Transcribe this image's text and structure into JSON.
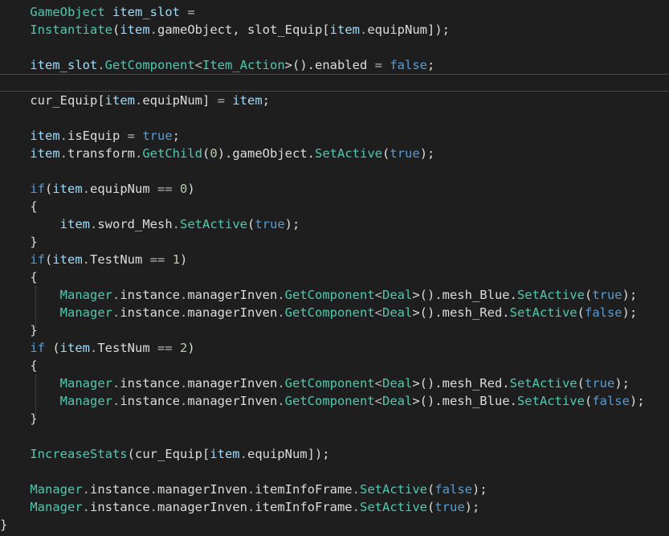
{
  "editor": {
    "language": "C#",
    "theme": "dark",
    "colors": {
      "background": "#1e1e1e",
      "type": "#4ec9b0",
      "variable": "#9cdcfe",
      "plain": "#dcdcdc",
      "keyword": "#569cd6",
      "number": "#b5cea8",
      "current_line_border": "#464646"
    },
    "current_line_index": 4,
    "lines": [
      {
        "tokens": [
          {
            "t": "    "
          },
          {
            "t": "GameObject",
            "c": "type"
          },
          {
            "t": " "
          },
          {
            "t": "item_slot",
            "c": "var"
          },
          {
            "t": " ",
            "c": "plain"
          },
          {
            "t": "=",
            "c": "op"
          }
        ]
      },
      {
        "tokens": [
          {
            "t": "    "
          },
          {
            "t": "Instantiate",
            "c": "type"
          },
          {
            "t": "(",
            "c": "plain"
          },
          {
            "t": "item",
            "c": "var"
          },
          {
            "t": ".",
            "c": "op"
          },
          {
            "t": "gameObject",
            "c": "plain"
          },
          {
            "t": ", slot_Equip[",
            "c": "plain"
          },
          {
            "t": "item",
            "c": "var"
          },
          {
            "t": ".",
            "c": "op"
          },
          {
            "t": "equipNum",
            "c": "plain"
          },
          {
            "t": "]);",
            "c": "plain"
          }
        ]
      },
      {
        "tokens": []
      },
      {
        "tokens": [
          {
            "t": "    "
          },
          {
            "t": "item_slot",
            "c": "var"
          },
          {
            "t": ".",
            "c": "op"
          },
          {
            "t": "GetComponent",
            "c": "type"
          },
          {
            "t": "<",
            "c": "op"
          },
          {
            "t": "Item_Action",
            "c": "type"
          },
          {
            "t": ">().enabled ",
            "c": "plain"
          },
          {
            "t": "=",
            "c": "op"
          },
          {
            "t": " "
          },
          {
            "t": "false",
            "c": "kw"
          },
          {
            "t": ";",
            "c": "plain"
          }
        ]
      },
      {
        "tokens": []
      },
      {
        "tokens": [
          {
            "t": "    "
          },
          {
            "t": "cur_Equip[",
            "c": "plain"
          },
          {
            "t": "item",
            "c": "var"
          },
          {
            "t": ".",
            "c": "op"
          },
          {
            "t": "equipNum] ",
            "c": "plain"
          },
          {
            "t": "=",
            "c": "op"
          },
          {
            "t": " "
          },
          {
            "t": "item",
            "c": "var"
          },
          {
            "t": ";",
            "c": "plain"
          }
        ]
      },
      {
        "tokens": []
      },
      {
        "tokens": [
          {
            "t": "    "
          },
          {
            "t": "item",
            "c": "var"
          },
          {
            "t": ".",
            "c": "op"
          },
          {
            "t": "isEquip ",
            "c": "plain"
          },
          {
            "t": "=",
            "c": "op"
          },
          {
            "t": " "
          },
          {
            "t": "true",
            "c": "kw"
          },
          {
            "t": ";",
            "c": "plain"
          }
        ]
      },
      {
        "tokens": [
          {
            "t": "    "
          },
          {
            "t": "item",
            "c": "var"
          },
          {
            "t": ".",
            "c": "op"
          },
          {
            "t": "transform",
            "c": "plain"
          },
          {
            "t": ".",
            "c": "op"
          },
          {
            "t": "GetChild",
            "c": "type"
          },
          {
            "t": "(",
            "c": "plain"
          },
          {
            "t": "0",
            "c": "num"
          },
          {
            "t": ").gameObject.",
            "c": "plain"
          },
          {
            "t": "SetActive",
            "c": "type"
          },
          {
            "t": "(",
            "c": "plain"
          },
          {
            "t": "true",
            "c": "kw"
          },
          {
            "t": ");",
            "c": "plain"
          }
        ]
      },
      {
        "tokens": []
      },
      {
        "tokens": [
          {
            "t": "    "
          },
          {
            "t": "if",
            "c": "kw"
          },
          {
            "t": "(",
            "c": "plain"
          },
          {
            "t": "item",
            "c": "var"
          },
          {
            "t": ".",
            "c": "op"
          },
          {
            "t": "equipNum ",
            "c": "plain"
          },
          {
            "t": "==",
            "c": "op"
          },
          {
            "t": " "
          },
          {
            "t": "0",
            "c": "num"
          },
          {
            "t": ")",
            "c": "plain"
          }
        ]
      },
      {
        "tokens": [
          {
            "t": "    "
          },
          {
            "t": "{",
            "c": "plain"
          }
        ]
      },
      {
        "tokens": [
          {
            "t": "        "
          },
          {
            "t": "item",
            "c": "var"
          },
          {
            "t": ".",
            "c": "op"
          },
          {
            "t": "sword_Mesh",
            "c": "plain"
          },
          {
            "t": ".",
            "c": "op"
          },
          {
            "t": "SetActive",
            "c": "type"
          },
          {
            "t": "(",
            "c": "plain"
          },
          {
            "t": "true",
            "c": "kw"
          },
          {
            "t": ");",
            "c": "plain"
          }
        ]
      },
      {
        "tokens": [
          {
            "t": "    "
          },
          {
            "t": "}",
            "c": "plain"
          }
        ]
      },
      {
        "tokens": [
          {
            "t": "    "
          },
          {
            "t": "if",
            "c": "kw"
          },
          {
            "t": "(",
            "c": "plain"
          },
          {
            "t": "item",
            "c": "var"
          },
          {
            "t": ".",
            "c": "op"
          },
          {
            "t": "TestNum ",
            "c": "plain"
          },
          {
            "t": "==",
            "c": "op"
          },
          {
            "t": " "
          },
          {
            "t": "1",
            "c": "num"
          },
          {
            "t": ")",
            "c": "plain"
          }
        ]
      },
      {
        "tokens": [
          {
            "t": "    "
          },
          {
            "t": "{",
            "c": "plain"
          }
        ]
      },
      {
        "tokens": [
          {
            "t": "        "
          },
          {
            "t": "Manager",
            "c": "type"
          },
          {
            "t": ".",
            "c": "op"
          },
          {
            "t": "instance",
            "c": "plain"
          },
          {
            "t": ".",
            "c": "op"
          },
          {
            "t": "managerInven",
            "c": "plain"
          },
          {
            "t": ".",
            "c": "op"
          },
          {
            "t": "GetComponent",
            "c": "type"
          },
          {
            "t": "<",
            "c": "op"
          },
          {
            "t": "Deal",
            "c": "type"
          },
          {
            "t": ">().mesh_Blue.",
            "c": "plain"
          },
          {
            "t": "SetActive",
            "c": "type"
          },
          {
            "t": "(",
            "c": "plain"
          },
          {
            "t": "true",
            "c": "kw"
          },
          {
            "t": ");",
            "c": "plain"
          }
        ]
      },
      {
        "tokens": [
          {
            "t": "        "
          },
          {
            "t": "Manager",
            "c": "type"
          },
          {
            "t": ".",
            "c": "op"
          },
          {
            "t": "instance",
            "c": "plain"
          },
          {
            "t": ".",
            "c": "op"
          },
          {
            "t": "managerInven",
            "c": "plain"
          },
          {
            "t": ".",
            "c": "op"
          },
          {
            "t": "GetComponent",
            "c": "type"
          },
          {
            "t": "<",
            "c": "op"
          },
          {
            "t": "Deal",
            "c": "type"
          },
          {
            "t": ">().mesh_Red.",
            "c": "plain"
          },
          {
            "t": "SetActive",
            "c": "type"
          },
          {
            "t": "(",
            "c": "plain"
          },
          {
            "t": "false",
            "c": "kw"
          },
          {
            "t": ");",
            "c": "plain"
          }
        ]
      },
      {
        "tokens": [
          {
            "t": "    "
          },
          {
            "t": "}",
            "c": "plain"
          }
        ]
      },
      {
        "tokens": [
          {
            "t": "    "
          },
          {
            "t": "if",
            "c": "kw"
          },
          {
            "t": " (",
            "c": "plain"
          },
          {
            "t": "item",
            "c": "var"
          },
          {
            "t": ".",
            "c": "op"
          },
          {
            "t": "TestNum ",
            "c": "plain"
          },
          {
            "t": "==",
            "c": "op"
          },
          {
            "t": " "
          },
          {
            "t": "2",
            "c": "num"
          },
          {
            "t": ")",
            "c": "plain"
          }
        ]
      },
      {
        "tokens": [
          {
            "t": "    "
          },
          {
            "t": "{",
            "c": "plain"
          }
        ]
      },
      {
        "tokens": [
          {
            "t": "        "
          },
          {
            "t": "Manager",
            "c": "type"
          },
          {
            "t": ".",
            "c": "op"
          },
          {
            "t": "instance",
            "c": "plain"
          },
          {
            "t": ".",
            "c": "op"
          },
          {
            "t": "managerInven",
            "c": "plain"
          },
          {
            "t": ".",
            "c": "op"
          },
          {
            "t": "GetComponent",
            "c": "type"
          },
          {
            "t": "<",
            "c": "op"
          },
          {
            "t": "Deal",
            "c": "type"
          },
          {
            "t": ">().mesh_Red.",
            "c": "plain"
          },
          {
            "t": "SetActive",
            "c": "type"
          },
          {
            "t": "(",
            "c": "plain"
          },
          {
            "t": "true",
            "c": "kw"
          },
          {
            "t": ");",
            "c": "plain"
          }
        ]
      },
      {
        "tokens": [
          {
            "t": "        "
          },
          {
            "t": "Manager",
            "c": "type"
          },
          {
            "t": ".",
            "c": "op"
          },
          {
            "t": "instance",
            "c": "plain"
          },
          {
            "t": ".",
            "c": "op"
          },
          {
            "t": "managerInven",
            "c": "plain"
          },
          {
            "t": ".",
            "c": "op"
          },
          {
            "t": "GetComponent",
            "c": "type"
          },
          {
            "t": "<",
            "c": "op"
          },
          {
            "t": "Deal",
            "c": "type"
          },
          {
            "t": ">().mesh_Blue.",
            "c": "plain"
          },
          {
            "t": "SetActive",
            "c": "type"
          },
          {
            "t": "(",
            "c": "plain"
          },
          {
            "t": "false",
            "c": "kw"
          },
          {
            "t": ");",
            "c": "plain"
          }
        ]
      },
      {
        "tokens": [
          {
            "t": "    "
          },
          {
            "t": "}",
            "c": "plain"
          }
        ]
      },
      {
        "tokens": []
      },
      {
        "tokens": [
          {
            "t": "    "
          },
          {
            "t": "IncreaseStats",
            "c": "type"
          },
          {
            "t": "(cur_Equip[",
            "c": "plain"
          },
          {
            "t": "item",
            "c": "var"
          },
          {
            "t": ".",
            "c": "op"
          },
          {
            "t": "equipNum",
            "c": "plain"
          },
          {
            "t": "]);",
            "c": "plain"
          }
        ]
      },
      {
        "tokens": []
      },
      {
        "tokens": [
          {
            "t": "    "
          },
          {
            "t": "Manager",
            "c": "type"
          },
          {
            "t": ".",
            "c": "op"
          },
          {
            "t": "instance",
            "c": "plain"
          },
          {
            "t": ".",
            "c": "op"
          },
          {
            "t": "managerInven",
            "c": "plain"
          },
          {
            "t": ".",
            "c": "op"
          },
          {
            "t": "itemInfoFrame",
            "c": "plain"
          },
          {
            "t": ".",
            "c": "op"
          },
          {
            "t": "SetActive",
            "c": "type"
          },
          {
            "t": "(",
            "c": "plain"
          },
          {
            "t": "false",
            "c": "kw"
          },
          {
            "t": ");",
            "c": "plain"
          }
        ]
      },
      {
        "tokens": [
          {
            "t": "    "
          },
          {
            "t": "Manager",
            "c": "type"
          },
          {
            "t": ".",
            "c": "op"
          },
          {
            "t": "instance",
            "c": "plain"
          },
          {
            "t": ".",
            "c": "op"
          },
          {
            "t": "managerInven",
            "c": "plain"
          },
          {
            "t": ".",
            "c": "op"
          },
          {
            "t": "itemInfoFrame",
            "c": "plain"
          },
          {
            "t": ".",
            "c": "op"
          },
          {
            "t": "SetActive",
            "c": "type"
          },
          {
            "t": "(",
            "c": "plain"
          },
          {
            "t": "true",
            "c": "kw"
          },
          {
            "t": ");",
            "c": "plain"
          }
        ]
      },
      {
        "tokens": [
          {
            "t": "}",
            "c": "plain"
          }
        ]
      }
    ]
  }
}
